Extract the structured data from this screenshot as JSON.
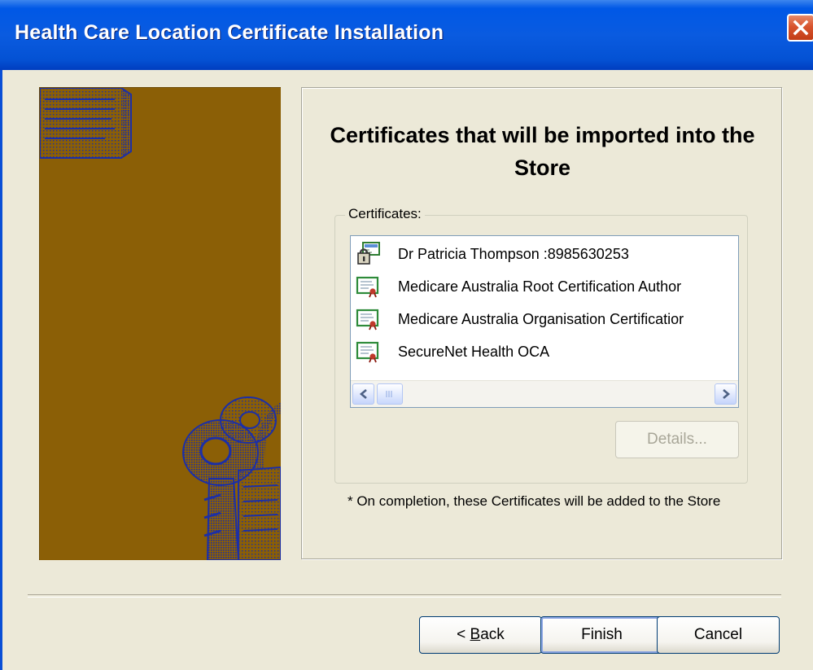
{
  "window": {
    "title": "Health Care Location Certificate Installation"
  },
  "main": {
    "heading": "Certificates that will be imported into the Store",
    "group_label": "Certificates:",
    "certificates": [
      {
        "label": "Dr Patricia Thompson :8985630253",
        "icon": "personal-certificate-lock-icon"
      },
      {
        "label": "Medicare Australia Root Certification Author",
        "icon": "certificate-icon"
      },
      {
        "label": "Medicare Australia Organisation Certificatior",
        "icon": "certificate-icon"
      },
      {
        "label": "SecureNet Health OCA",
        "icon": "certificate-icon"
      }
    ],
    "details_button": "Details...",
    "note": "* On completion, these Certificates will be added to the Store"
  },
  "footer": {
    "back_prefix": "< ",
    "back_mnemonic": "B",
    "back_rest": "ack",
    "finish": "Finish",
    "cancel": "Cancel"
  },
  "colors": {
    "title_bar": "#0a5be0",
    "side_panel": "#8b5f06",
    "artwork": "#1c2fa6",
    "dialog_bg": "#ece9d8",
    "close_button": "#d8542e"
  }
}
